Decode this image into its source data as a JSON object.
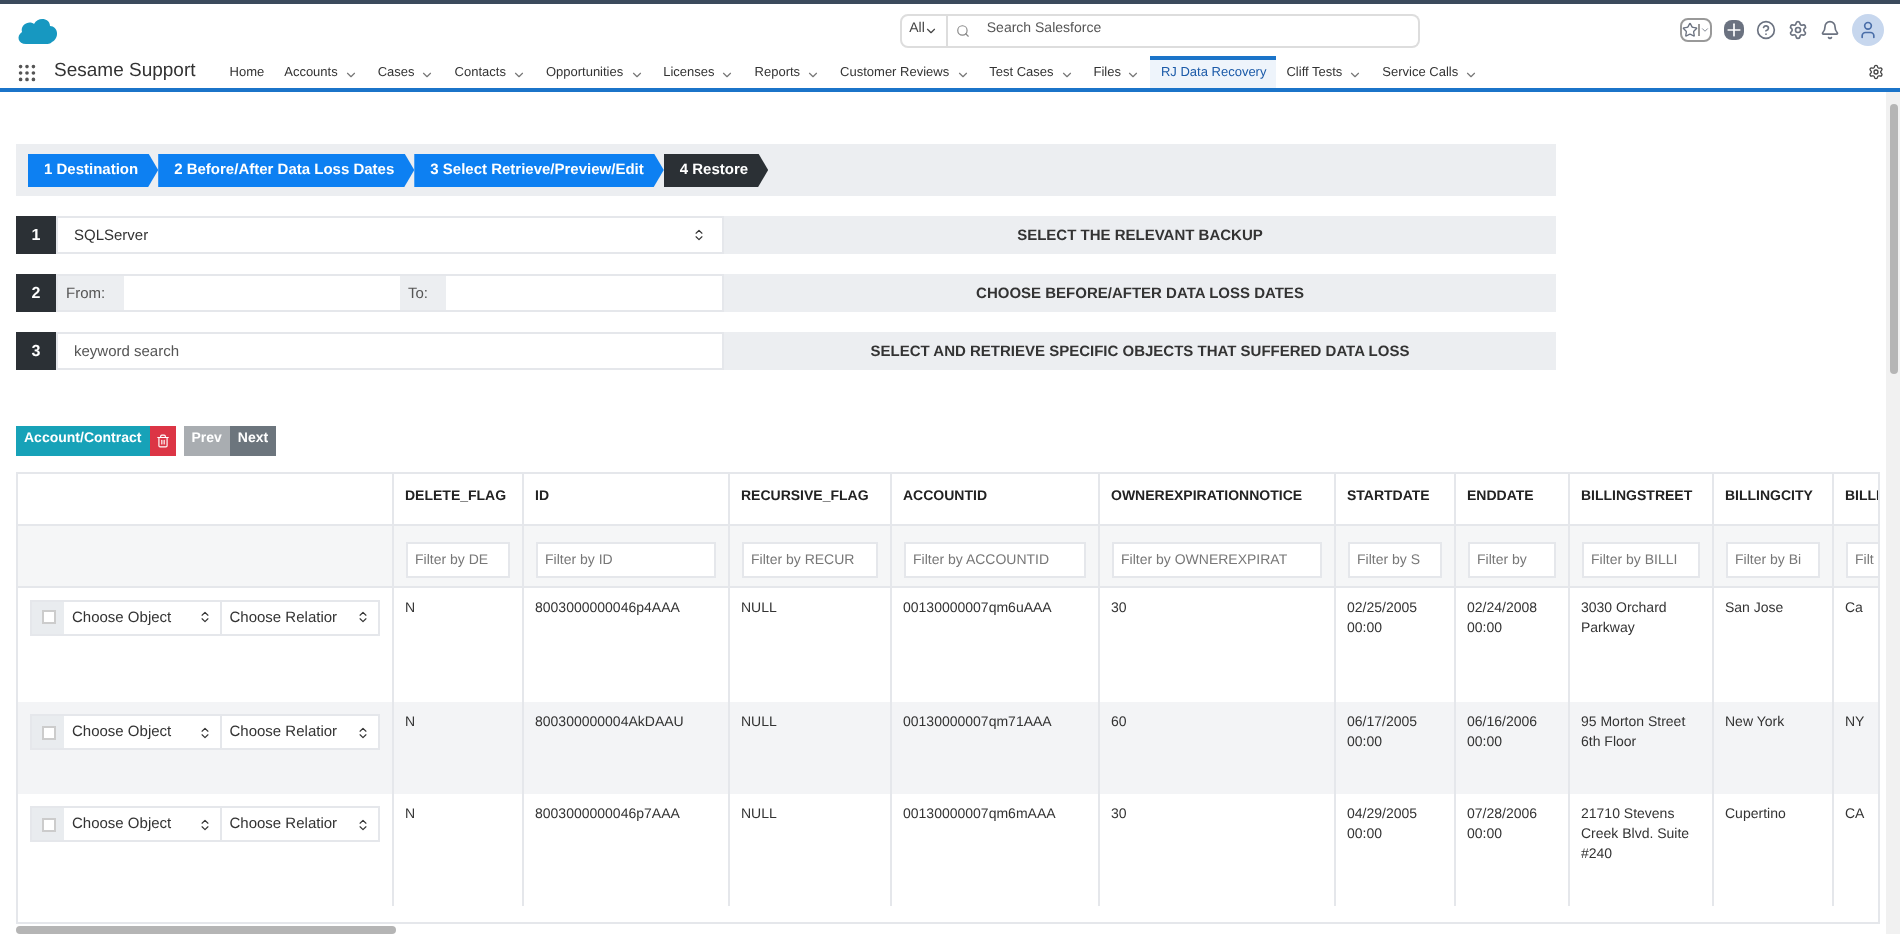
{
  "header": {
    "search": {
      "scope": "All",
      "placeholder": "Search Salesforce"
    }
  },
  "nav": {
    "app_name": "Sesame Support",
    "items": [
      {
        "label": "Home",
        "has_menu": false,
        "selected": false
      },
      {
        "label": "Accounts",
        "has_menu": true,
        "selected": false
      },
      {
        "label": "Cases",
        "has_menu": true,
        "selected": false
      },
      {
        "label": "Contacts",
        "has_menu": true,
        "selected": false
      },
      {
        "label": "Opportunities",
        "has_menu": true,
        "selected": false
      },
      {
        "label": "Licenses",
        "has_menu": true,
        "selected": false
      },
      {
        "label": "Reports",
        "has_menu": true,
        "selected": false
      },
      {
        "label": "Customer Reviews",
        "has_menu": true,
        "selected": false
      },
      {
        "label": "Test Cases",
        "has_menu": true,
        "selected": false
      },
      {
        "label": "Files",
        "has_menu": true,
        "selected": false
      },
      {
        "label": "RJ Data Recovery",
        "has_menu": false,
        "selected": true
      },
      {
        "label": "Cliff Tests",
        "has_menu": true,
        "selected": false
      },
      {
        "label": "Service Calls",
        "has_menu": true,
        "selected": false
      }
    ]
  },
  "wizard": {
    "steps": [
      {
        "label": "1 Destination",
        "selected": false
      },
      {
        "label": "2 Before/After Data Loss Dates",
        "selected": false
      },
      {
        "label": "3 Select Retrieve/Preview/Edit",
        "selected": false
      },
      {
        "label": "4 Restore",
        "selected": true
      }
    ]
  },
  "form_rows": [
    {
      "number": "1",
      "kind": "select",
      "value": "SQLServer",
      "label": "SELECT THE RELEVANT BACKUP"
    },
    {
      "number": "2",
      "kind": "dates",
      "from_label": "From:",
      "to_label": "To:",
      "label": "CHOOSE BEFORE/AFTER DATA LOSS DATES"
    },
    {
      "number": "3",
      "kind": "search",
      "placeholder": "keyword search",
      "label": "SELECT AND RETRIEVE SPECIFIC OBJECTS THAT SUFFERED DATA LOSS"
    }
  ],
  "toolbar": {
    "object_button": "Account/Contract",
    "pager": [
      {
        "label": "Prev",
        "disabled": true
      },
      {
        "label": "Next",
        "disabled": false
      }
    ]
  },
  "table": {
    "columns": [
      "DELETE_FLAG",
      "ID",
      "RECURSIVE_FLAG",
      "ACCOUNTID",
      "OWNEREXPIRATIONNOTICE",
      "STARTDATE",
      "ENDDATE",
      "BILLINGSTREET",
      "BILLINGCITY",
      "BILLI"
    ],
    "filter_placeholders": [
      "Filter by DE",
      "Filter by ID",
      "Filter by RECUR",
      "Filter by ACCOUNTID",
      "Filter by OWNEREXPIRAT",
      "Filter by S",
      "Filter by",
      "Filter by BILLI",
      "Filter by Bi",
      "Filt"
    ],
    "rows": [
      {
        "checked": false,
        "object": "Choose Object",
        "relation": "Choose Relatior",
        "cells": [
          "N",
          "8003000000046p4AAA",
          "NULL",
          "00130000007qm6uAAA",
          "30",
          "02/25/2005 00:00",
          "02/24/2008 00:00",
          "3030 Orchard Parkway",
          "San Jose",
          "Ca"
        ]
      },
      {
        "checked": false,
        "object": "Choose Object",
        "relation": "Choose Relatior",
        "cells": [
          "N",
          "800300000004AkDAAU",
          "NULL",
          "00130000007qm71AAA",
          "60",
          "06/17/2005 00:00",
          "06/16/2006 00:00",
          "95 Morton Street 6th Floor",
          "New York",
          "NY"
        ]
      },
      {
        "checked": false,
        "object": "Choose Object",
        "relation": "Choose Relatior",
        "cells": [
          "N",
          "8003000000046p7AAA",
          "NULL",
          "00130000007qm6mAAA",
          "30",
          "04/29/2005 00:00",
          "07/28/2006 00:00",
          "21710 Stevens Creek Blvd. Suite #240",
          "Cupertino",
          "CA"
        ]
      }
    ]
  }
}
